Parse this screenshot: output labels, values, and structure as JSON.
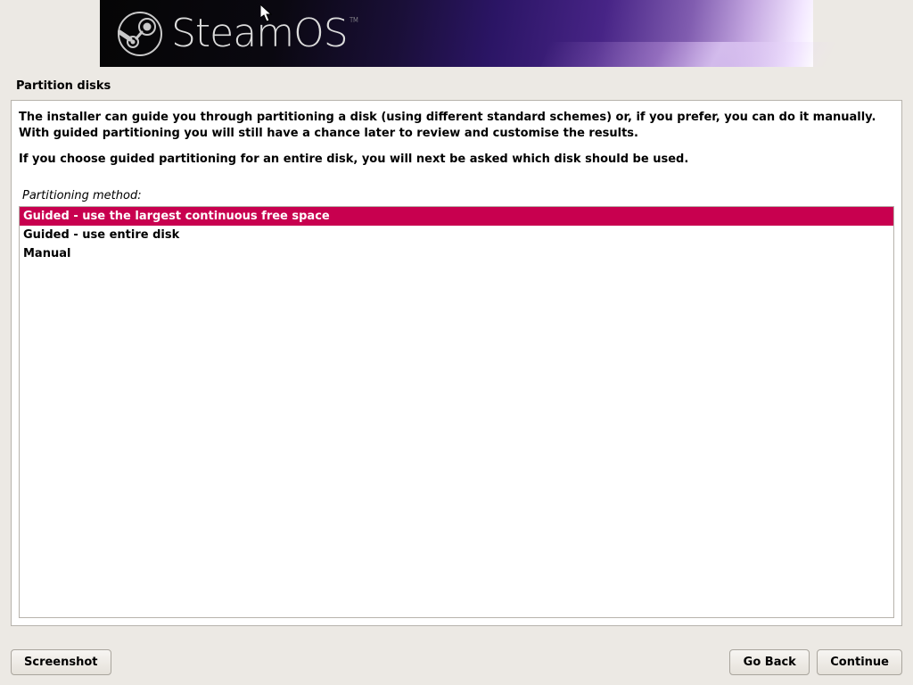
{
  "brand": {
    "name": "SteamOS",
    "tm": "TM"
  },
  "page_title": "Partition disks",
  "instructions": {
    "p1": "The installer can guide you through partitioning a disk (using different standard schemes) or, if you prefer, you can do it manually. With guided partitioning you will still have a chance later to review and customise the results.",
    "p2": "If you choose guided partitioning for an entire disk, you will next be asked which disk should be used."
  },
  "method_label": "Partitioning method:",
  "options": [
    {
      "label": "Guided - use the largest continuous free space",
      "selected": true
    },
    {
      "label": "Guided - use entire disk",
      "selected": false
    },
    {
      "label": "Manual",
      "selected": false
    }
  ],
  "buttons": {
    "screenshot": "Screenshot",
    "go_back": "Go Back",
    "continue": "Continue"
  }
}
